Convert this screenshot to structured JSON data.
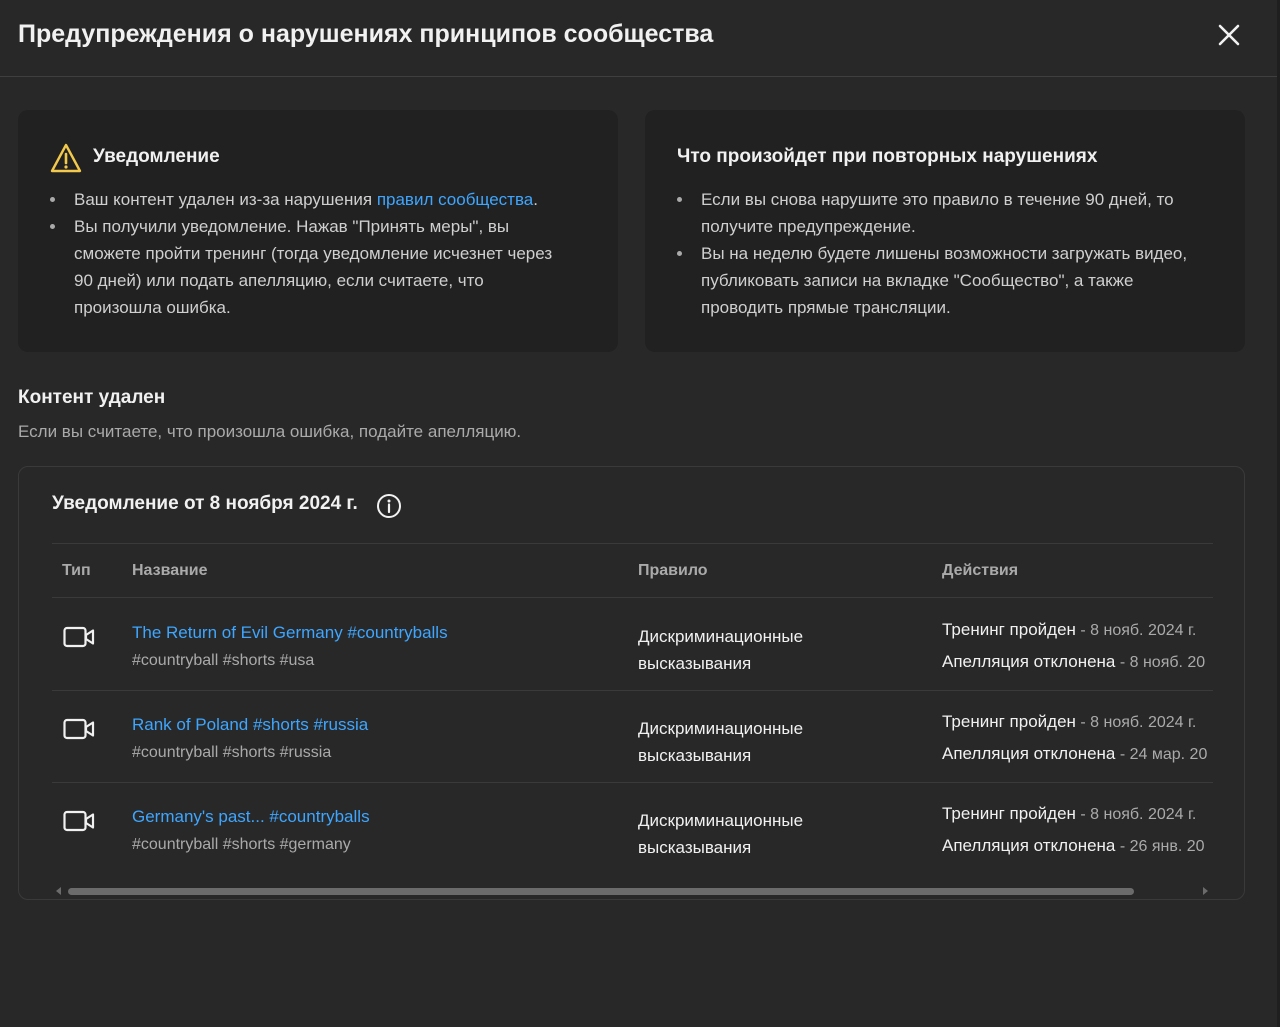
{
  "header": {
    "title": "Предупреждения о нарушениях принципов сообщества",
    "close_icon": "close-icon"
  },
  "notice_card": {
    "title": "Уведомление",
    "icon": "warning-icon",
    "icon_color": "#f2c94c",
    "bullet1_text": "Ваш контент удален из-за нарушения ",
    "bullet1_link": "правил сообщества",
    "bullet1_end": ".",
    "bullet2_line1": "Вы получили уведомление. Нажав \"Принять меры\", вы",
    "bullet2_line2": "сможете пройти тренинг (тогда уведомление исчезнет через",
    "bullet2_line3": "90 дней) или подать апелляцию, если считаете, что",
    "bullet2_line4": "произошла ошибка."
  },
  "repeat_card": {
    "title": "Что произойдет при повторных нарушениях",
    "bullet1_line1": "Если вы снова нарушите это правило в течение 90 дней, то",
    "bullet1_line2": "получите предупреждение.",
    "bullet2_line1": "Вы на неделю будете лишены возможности загружать видео,",
    "bullet2_line2": "публиковать записи на вкладке \"Сообщество\", а также",
    "bullet2_line3": "проводить прямые трансляции."
  },
  "content_section": {
    "title": "Контент удален",
    "subtitle": "Если вы считаете, что произошла ошибка, подайте апелляцию."
  },
  "notice_table": {
    "title": "Уведомление от 8 ноября 2024 г.",
    "info_icon": "info-icon",
    "headers": {
      "type": "Тип",
      "name": "Название",
      "rule": "Правило",
      "actions": "Действия"
    },
    "rows": [
      {
        "type_icon": "video-icon",
        "title": "The Return of Evil Germany #countryballs",
        "tags": "#countryball #shorts #usa",
        "rule_line1": "Дискриминационные",
        "rule_line2": "высказывания",
        "action1": "Тренинг пройден",
        "action1_date": " - 8 нояб. 2024 г.",
        "action2": "Апелляция отклонена",
        "action2_date": " - 8 нояб. 20"
      },
      {
        "type_icon": "video-icon",
        "title": "Rank of Poland #shorts #russia",
        "tags": "#countryball #shorts #russia",
        "rule_line1": "Дискриминационные",
        "rule_line2": "высказывания",
        "action1": "Тренинг пройден",
        "action1_date": " - 8 нояб. 2024 г.",
        "action2": "Апелляция отклонена",
        "action2_date": " - 24 мар. 20"
      },
      {
        "type_icon": "video-icon",
        "title": "Germany's past... #countryballs",
        "tags": "#countryball #shorts #germany",
        "rule_line1": "Дискриминационные",
        "rule_line2": "высказывания",
        "action1": "Тренинг пройден",
        "action1_date": " - 8 нояб. 2024 г.",
        "action2": "Апелляция отклонена",
        "action2_date": " - 26 янв. 20"
      }
    ]
  },
  "colors": {
    "background": "#282828",
    "card": "#212121",
    "link": "#3ea6ff",
    "text": "#f1f1f1",
    "muted": "#aaaaaa"
  }
}
